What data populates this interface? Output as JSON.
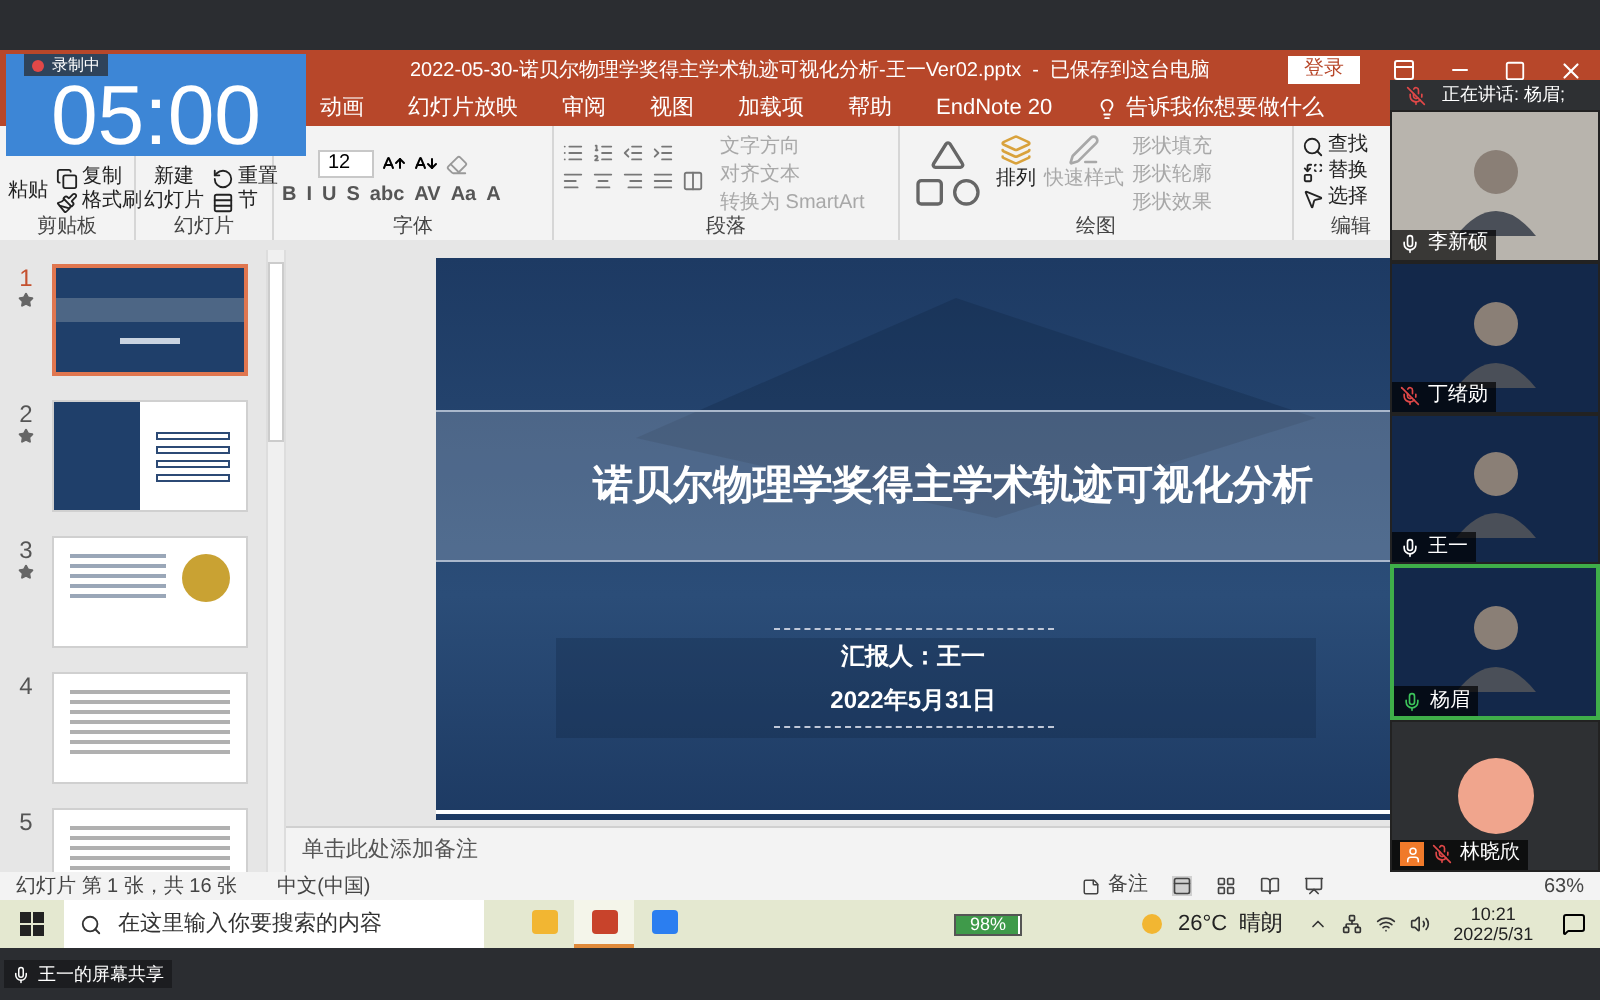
{
  "meeting": {
    "recording": "录制中",
    "timer": "05:00",
    "speaking": "正在讲话: 杨眉;",
    "share_label": "王一的屏幕共享",
    "participants": [
      {
        "name": "李新硕",
        "muted": false,
        "speaking": false,
        "kind": "video",
        "host": false
      },
      {
        "name": "丁绪勋",
        "muted": true,
        "speaking": false,
        "kind": "video",
        "host": false
      },
      {
        "name": "王一",
        "muted": false,
        "speaking": false,
        "kind": "video",
        "host": false
      },
      {
        "name": "杨眉",
        "muted": false,
        "speaking": true,
        "kind": "video",
        "host": false
      },
      {
        "name": "林晓欣",
        "muted": true,
        "speaking": false,
        "kind": "avatar",
        "host": true
      }
    ]
  },
  "window": {
    "title": "2022-05-30-诺贝尔物理学奖得主学术轨迹可视化分析-王一Ver02.pptx  -  已保存到这台电脑",
    "login": "登录"
  },
  "ribbon": {
    "tabs": [
      "动画",
      "幻灯片放映",
      "审阅",
      "视图",
      "加载项",
      "帮助",
      "EndNote 20"
    ],
    "tell_me": "告诉我你想要做什么",
    "clipboard": {
      "label": "剪贴板",
      "paste": "粘贴",
      "copy": "复制",
      "format_painter": "格式刷"
    },
    "slides": {
      "label": "幻灯片",
      "new_slide": [
        "新建",
        "幻灯片"
      ],
      "reset": "重置",
      "section": "节"
    },
    "font": {
      "label": "字体",
      "size": "12",
      "styles": [
        "B",
        "I",
        "U",
        "S",
        "abc",
        "AV",
        "Aa",
        "A"
      ]
    },
    "paragraph": {
      "label": "段落",
      "commands": [
        {
          "label": "文字方向",
          "disabled": true
        },
        {
          "label": "对齐文本",
          "disabled": true
        },
        {
          "label": "转换为 SmartArt",
          "disabled": true
        }
      ]
    },
    "drawing": {
      "label": "绘图",
      "arrange": "排列",
      "quick_styles": {
        "label": "快速样式",
        "disabled": true
      },
      "commands": [
        {
          "label": "形状填充",
          "disabled": true
        },
        {
          "label": "形状轮廓",
          "disabled": true
        },
        {
          "label": "形状效果",
          "disabled": true
        }
      ]
    },
    "editing": {
      "label": "编辑",
      "commands": [
        "查找",
        "替换",
        "选择"
      ]
    }
  },
  "thumbnails": [
    {
      "number": "1",
      "kind": "title",
      "animated": true,
      "selected": true
    },
    {
      "number": "2",
      "kind": "toc",
      "animated": true,
      "selected": false
    },
    {
      "number": "3",
      "kind": "image",
      "animated": true,
      "selected": false
    },
    {
      "number": "4",
      "kind": "text",
      "animated": false,
      "selected": false
    },
    {
      "number": "5",
      "kind": "text",
      "animated": false,
      "selected": false
    }
  ],
  "slide": {
    "title": "诺贝尔物理学奖得主学术轨迹可视化分析",
    "presenter": "汇报人：王一",
    "date": "2022年5月31日"
  },
  "notes_placeholder": "单击此处添加备注",
  "status_bar": {
    "slide_info": "幻灯片 第 1 张，共 16 张",
    "language": "中文(中国)",
    "notes": "备注",
    "views": [
      {
        "kind": "normal",
        "selected": true
      },
      {
        "kind": "sorter",
        "selected": false
      },
      {
        "kind": "reading",
        "selected": false
      },
      {
        "kind": "slideshow",
        "selected": false
      }
    ],
    "zoom": "63%"
  },
  "taskbar": {
    "search_placeholder": "在这里输入你要搜索的内容",
    "apps": [
      {
        "kind": "folder",
        "selected": false
      },
      {
        "kind": "powerpoint",
        "selected": true
      },
      {
        "kind": "meeting",
        "selected": false
      }
    ],
    "battery": {
      "reading": "98%",
      "level": 0.98
    },
    "temperature": "26°C",
    "weather": "晴朗",
    "time": "10:21",
    "date": "2022/5/31"
  }
}
